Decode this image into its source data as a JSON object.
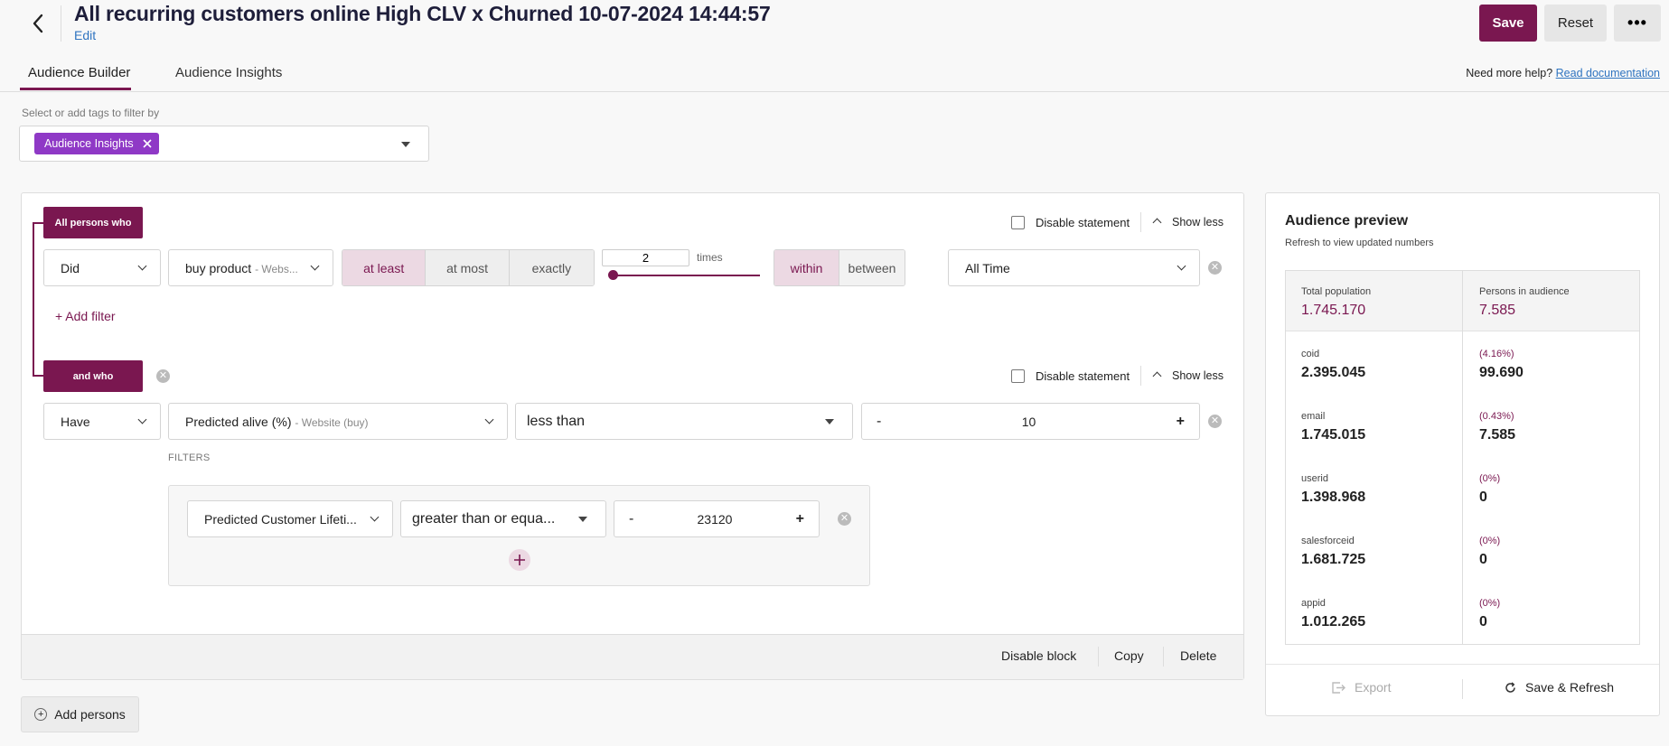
{
  "header": {
    "title": "All recurring customers online High CLV x Churned 10-07-2024 14:44:57",
    "edit_label": "Edit",
    "save_label": "Save",
    "reset_label": "Reset"
  },
  "tabs": [
    {
      "label": "Audience Builder",
      "active": true
    },
    {
      "label": "Audience Insights",
      "active": false
    }
  ],
  "help": {
    "text": "Need more help?",
    "link": "Read documentation"
  },
  "tag_filter": {
    "caption": "Select or add tags to filter by",
    "tags": [
      "Audience Insights"
    ]
  },
  "colors": {
    "accent": "#7a1750",
    "tag": "#8f39c6",
    "link": "#2f74c0"
  },
  "statement1": {
    "pill": "All persons who",
    "disable_label": "Disable statement",
    "show_less": "Show less",
    "verb": "Did",
    "event": "buy product",
    "event_source": "- Webs...",
    "modes": [
      "at least",
      "at most",
      "exactly"
    ],
    "active_mode": "at least",
    "count": "2",
    "count_unit": "times",
    "range_modes": [
      "within",
      "between"
    ],
    "active_range": "within",
    "period": "All Time",
    "add_filter": "Add filter"
  },
  "statement2": {
    "pill": "and who",
    "disable_label": "Disable statement",
    "show_less": "Show less",
    "verb": "Have",
    "property": "Predicted alive (%)",
    "property_source": "- Website (buy)",
    "operator": "less than",
    "value": "10",
    "filters_caption": "FILTERS",
    "filter": {
      "property": "Predicted Customer Lifeti...",
      "operator": "greater than or equa...",
      "value": "23120"
    }
  },
  "block_actions": {
    "disable": "Disable block",
    "copy": "Copy",
    "delete": "Delete"
  },
  "add_persons": "Add persons",
  "preview": {
    "title": "Audience preview",
    "subtitle": "Refresh to view updated numbers",
    "total_label": "Total population",
    "total_value": "1.745.170",
    "audience_label": "Persons in audience",
    "audience_value": "7.585",
    "rows": [
      {
        "id": "coid",
        "total": "2.395.045",
        "pct": "(4.16%)",
        "audience": "99.690"
      },
      {
        "id": "email",
        "total": "1.745.015",
        "pct": "(0.43%)",
        "audience": "7.585"
      },
      {
        "id": "userid",
        "total": "1.398.968",
        "pct": "(0%)",
        "audience": "0"
      },
      {
        "id": "salesforceid",
        "total": "1.681.725",
        "pct": "(0%)",
        "audience": "0"
      },
      {
        "id": "appid",
        "total": "1.012.265",
        "pct": "(0%)",
        "audience": "0"
      }
    ],
    "export_label": "Export",
    "save_refresh_label": "Save & Refresh"
  }
}
